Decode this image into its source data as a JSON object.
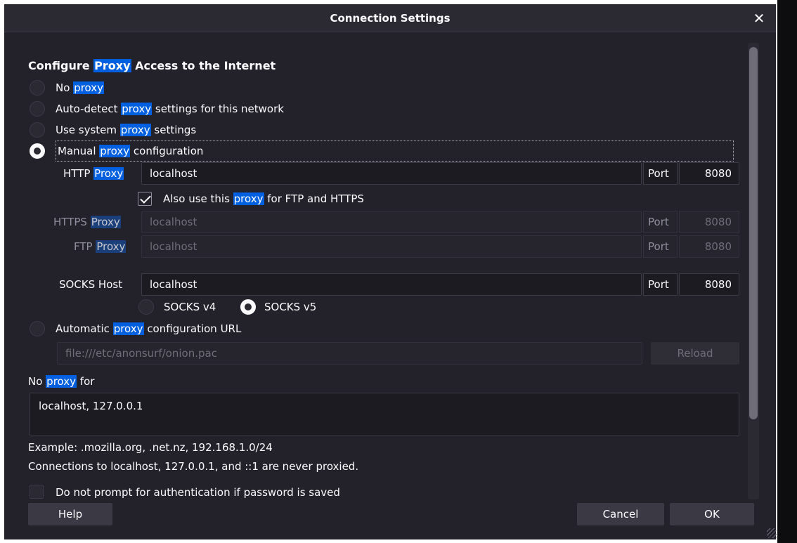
{
  "window": {
    "title": "Connection Settings",
    "close_icon": "✕"
  },
  "heading": {
    "pre": "Configure ",
    "hl": "Proxy",
    "post": " Access to the Internet"
  },
  "options": {
    "no_proxy": {
      "pre": "No ",
      "hl": "proxy",
      "post": "",
      "selected": false
    },
    "auto_detect": {
      "pre": "Auto-detect ",
      "hl": "proxy",
      "post": " settings for this network",
      "selected": false
    },
    "use_system": {
      "pre": "Use system ",
      "hl": "proxy",
      "post": " settings",
      "selected": false
    },
    "manual": {
      "pre": "Manual ",
      "hl": "proxy",
      "post": " configuration",
      "selected": true
    },
    "auto_url": {
      "pre": "Automatic ",
      "hl": "proxy",
      "post": " configuration URL",
      "selected": false
    }
  },
  "http": {
    "label_pre": "HTTP ",
    "label_hl": "Proxy",
    "host": "localhost",
    "port_label": "Port",
    "port": "8080"
  },
  "also_use": {
    "pre": "Also use this ",
    "hl": "proxy",
    "post": " for FTP and HTTPS",
    "checked": true
  },
  "https": {
    "label_pre": "HTTPS ",
    "label_hl": "Proxy",
    "host": "localhost",
    "port_label": "Port",
    "port": "8080"
  },
  "ftp": {
    "label_pre": "FTP ",
    "label_hl": "Proxy",
    "host": "localhost",
    "port_label": "Port",
    "port": "8080"
  },
  "socks": {
    "label": "SOCKS Host",
    "host": "localhost",
    "port_label": "Port",
    "port": "8080",
    "v4": "SOCKS v4",
    "v5": "SOCKS v5",
    "selected": "v5"
  },
  "pac": {
    "url": "file:///etc/anonsurf/onion.pac",
    "reload": "Reload"
  },
  "no_proxy_for": {
    "pre": "No ",
    "hl": "proxy",
    "post": " for",
    "value": "localhost, 127.0.0.1"
  },
  "example": "Example: .mozilla.org, .net.nz, 192.168.1.0/24",
  "never_proxied": "Connections to localhost, 127.0.0.1, and ::1 are never proxied.",
  "no_prompt": {
    "label": "Do not prompt for authentication if password is saved",
    "checked": false
  },
  "buttons": {
    "help": "Help",
    "cancel": "Cancel",
    "ok": "OK"
  },
  "colors": {
    "dialog_bg": "#23222b",
    "highlight": "#0060df",
    "field_bg": "#1c1b22"
  }
}
